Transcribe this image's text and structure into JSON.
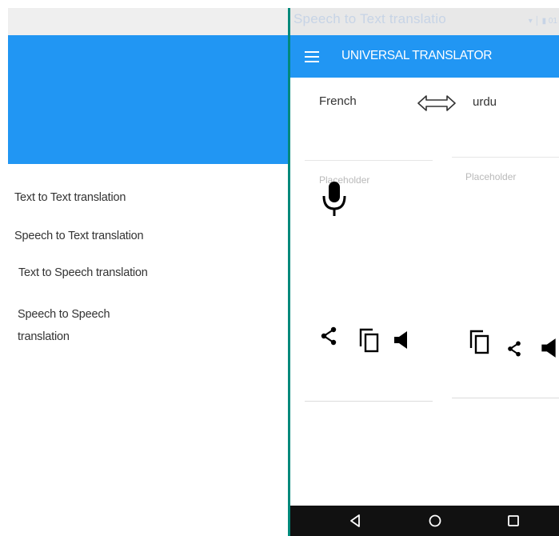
{
  "drawer": {
    "items": [
      "Text to Text translation",
      "Speech to Text translation",
      "Text to Speech translation",
      "Speech to Speech",
      "translation"
    ]
  },
  "status_bar": {
    "text": "Speech to Text translatio",
    "icons": "▾ │ ▮ 01"
  },
  "app_bar": {
    "title": "UNIVERSAL TRANSLATOR"
  },
  "languages": {
    "source": "French",
    "target": "urdu"
  },
  "text_areas": {
    "left_placeholder": "Placeholder",
    "right_placeholder": "Placeholder"
  },
  "colors": {
    "primary": "#2196f3",
    "accent_border": "#00897b",
    "nav_bar": "#111111"
  }
}
